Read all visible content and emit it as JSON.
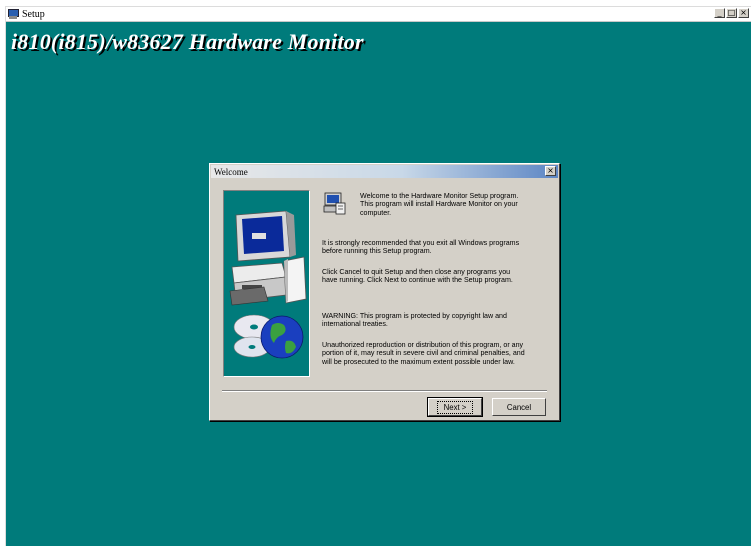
{
  "window": {
    "title": "Setup",
    "controls": {
      "minimize": "_",
      "maximize": "□",
      "close": "×"
    }
  },
  "banner": {
    "text": "i810(i815)/w83627 Hardware Monitor"
  },
  "dialog": {
    "title": "Welcome",
    "close": "×",
    "paragraphs": {
      "welcome": "Welcome to the Hardware Monitor Setup program.\nThis program will install Hardware Monitor on your\ncomputer.",
      "recommend": "It is strongly recommended that you exit all Windows programs\nbefore running this Setup program.",
      "instructions": "Click Cancel to quit Setup and then close any programs you\nhave running.  Click Next to continue with the Setup program.",
      "warning": "WARNING: This program is protected by copyright law and\ninternational treaties.",
      "legal": "Unauthorized reproduction or distribution of this program, or any\nportion of it, may result in severe civil and criminal penalties, and\nwill be prosecuted to the maximum extent possible under law."
    },
    "buttons": {
      "next": "Next >",
      "cancel": "Cancel"
    }
  },
  "colors": {
    "desktop": "#007b7b",
    "dialog_face": "#d4d0c8",
    "title_gradient_end": "#5d86c4"
  },
  "icons": [
    "setup-app-icon",
    "computer-illustration",
    "globe-cd-illustration",
    "setup-program-icon"
  ]
}
